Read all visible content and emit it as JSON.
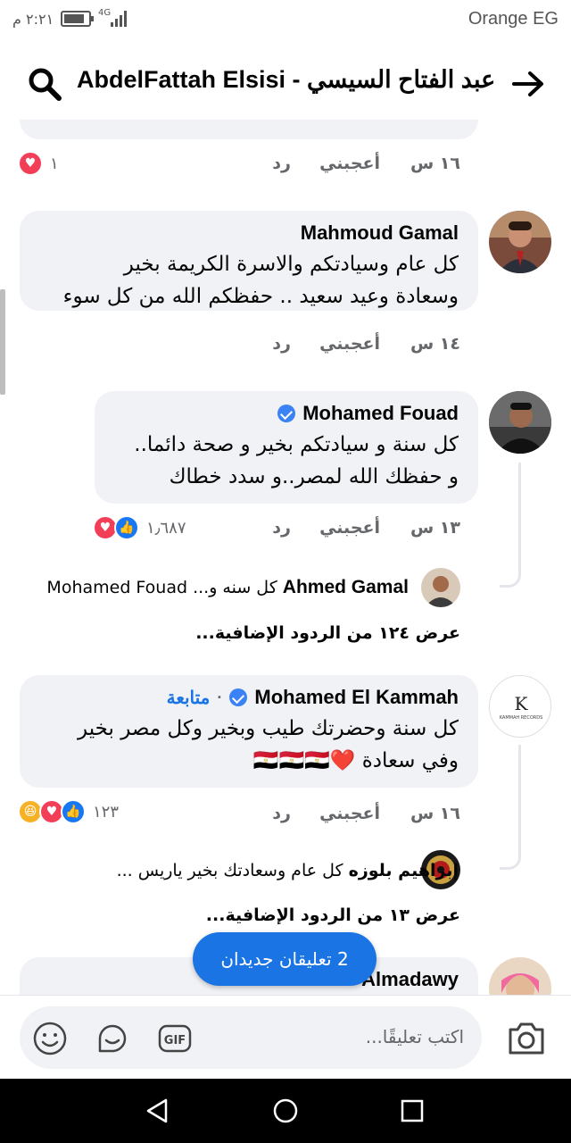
{
  "status_bar": {
    "carrier": "Orange EG",
    "time": "٢:٢١ م",
    "network": "4G"
  },
  "header": {
    "title": "AbdelFattah Elsisi - عبد الفتاح السيسي"
  },
  "top_comment": {
    "age": "١٦ س",
    "like_label": "أعجبني",
    "reply_label": "رد",
    "reaction_count": "١"
  },
  "comments": [
    {
      "author": "Mahmoud Gamal",
      "text_line1": "كل عام وسيادتكم والاسرة الكريمة بخير",
      "text_line2": "وسعادة وعيد سعيد .. حفظكم الله من كل سوء",
      "age": "١٤ س",
      "like_label": "أعجبني",
      "reply_label": "رد"
    },
    {
      "author": "Mohamed Fouad",
      "verified": true,
      "text_line1": "كل سنة و سيادتكم بخير و صحة دائما..",
      "text_line2": "و حفظك الله لمصر..و سدد خطاك",
      "age": "١٣ س",
      "like_label": "أعجبني",
      "reply_label": "رد",
      "reaction_count": "١٫٦٨٧",
      "reply_preview": {
        "author": "Ahmed Gamal",
        "text": "كل سنه و... Mohamed Fouad"
      },
      "more_replies": "عرض ١٢٤ من الردود الإضافية..."
    },
    {
      "author": "Mohamed El Kammah",
      "verified": true,
      "follow_label": "متابعة",
      "text_line1": "كل سنة وحضرتك طيب وبخير وكل مصر بخير",
      "text_line2": "وفي سعادة ❤️🇪🇬🇪🇬🇪🇬",
      "age": "١٦ س",
      "like_label": "أعجبني",
      "reply_label": "رد",
      "reaction_count": "١٢٣",
      "reply_preview": {
        "author": "إبراهيم بلوزه",
        "text": "كل عام وسعادتك بخير ياريس ..."
      },
      "more_replies": "عرض ١٣ من الردود الإضافية..."
    },
    {
      "author": "Almadawy"
    }
  ],
  "new_comments_label": "2 تعليقان جديدان",
  "composer": {
    "placeholder": "اكتب تعليقًا..."
  },
  "avatar_logo_text": "K",
  "colors": {
    "accent": "#1b74e4",
    "bubble": "#f0f2f5",
    "meta_text": "#65676b"
  }
}
